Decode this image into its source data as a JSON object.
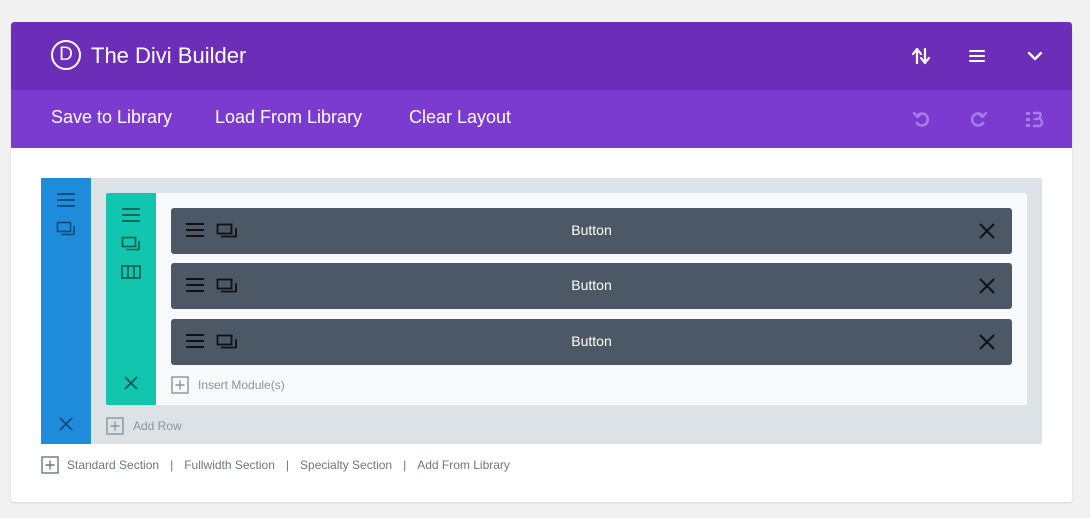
{
  "header": {
    "logo_letter": "D",
    "title": "The Divi Builder",
    "icons": [
      "sort-icon",
      "menu-icon",
      "chevron-down-icon"
    ]
  },
  "toolbar": {
    "save_label": "Save to Library",
    "load_label": "Load From Library",
    "clear_label": "Clear Layout",
    "icons": [
      "undo-icon",
      "redo-icon",
      "history-icon"
    ]
  },
  "builder": {
    "modules": [
      {
        "label": "Button"
      },
      {
        "label": "Button"
      },
      {
        "label": "Button"
      }
    ],
    "insert_module_label": "Insert Module(s)",
    "add_row_label": "Add Row"
  },
  "footer": {
    "standard_section": "Standard Section",
    "fullwidth_section": "Fullwidth Section",
    "specialty_section": "Specialty Section",
    "add_from_library": "Add From Library",
    "separator": "|"
  },
  "colors": {
    "header_bg": "#6c2eb9",
    "toolbar_bg": "#7b3bd0",
    "section_bar": "#1e8cdb",
    "row_bar": "#12c5ae",
    "module_bg": "#4c5866",
    "builder_bg": "#dde2e6"
  }
}
